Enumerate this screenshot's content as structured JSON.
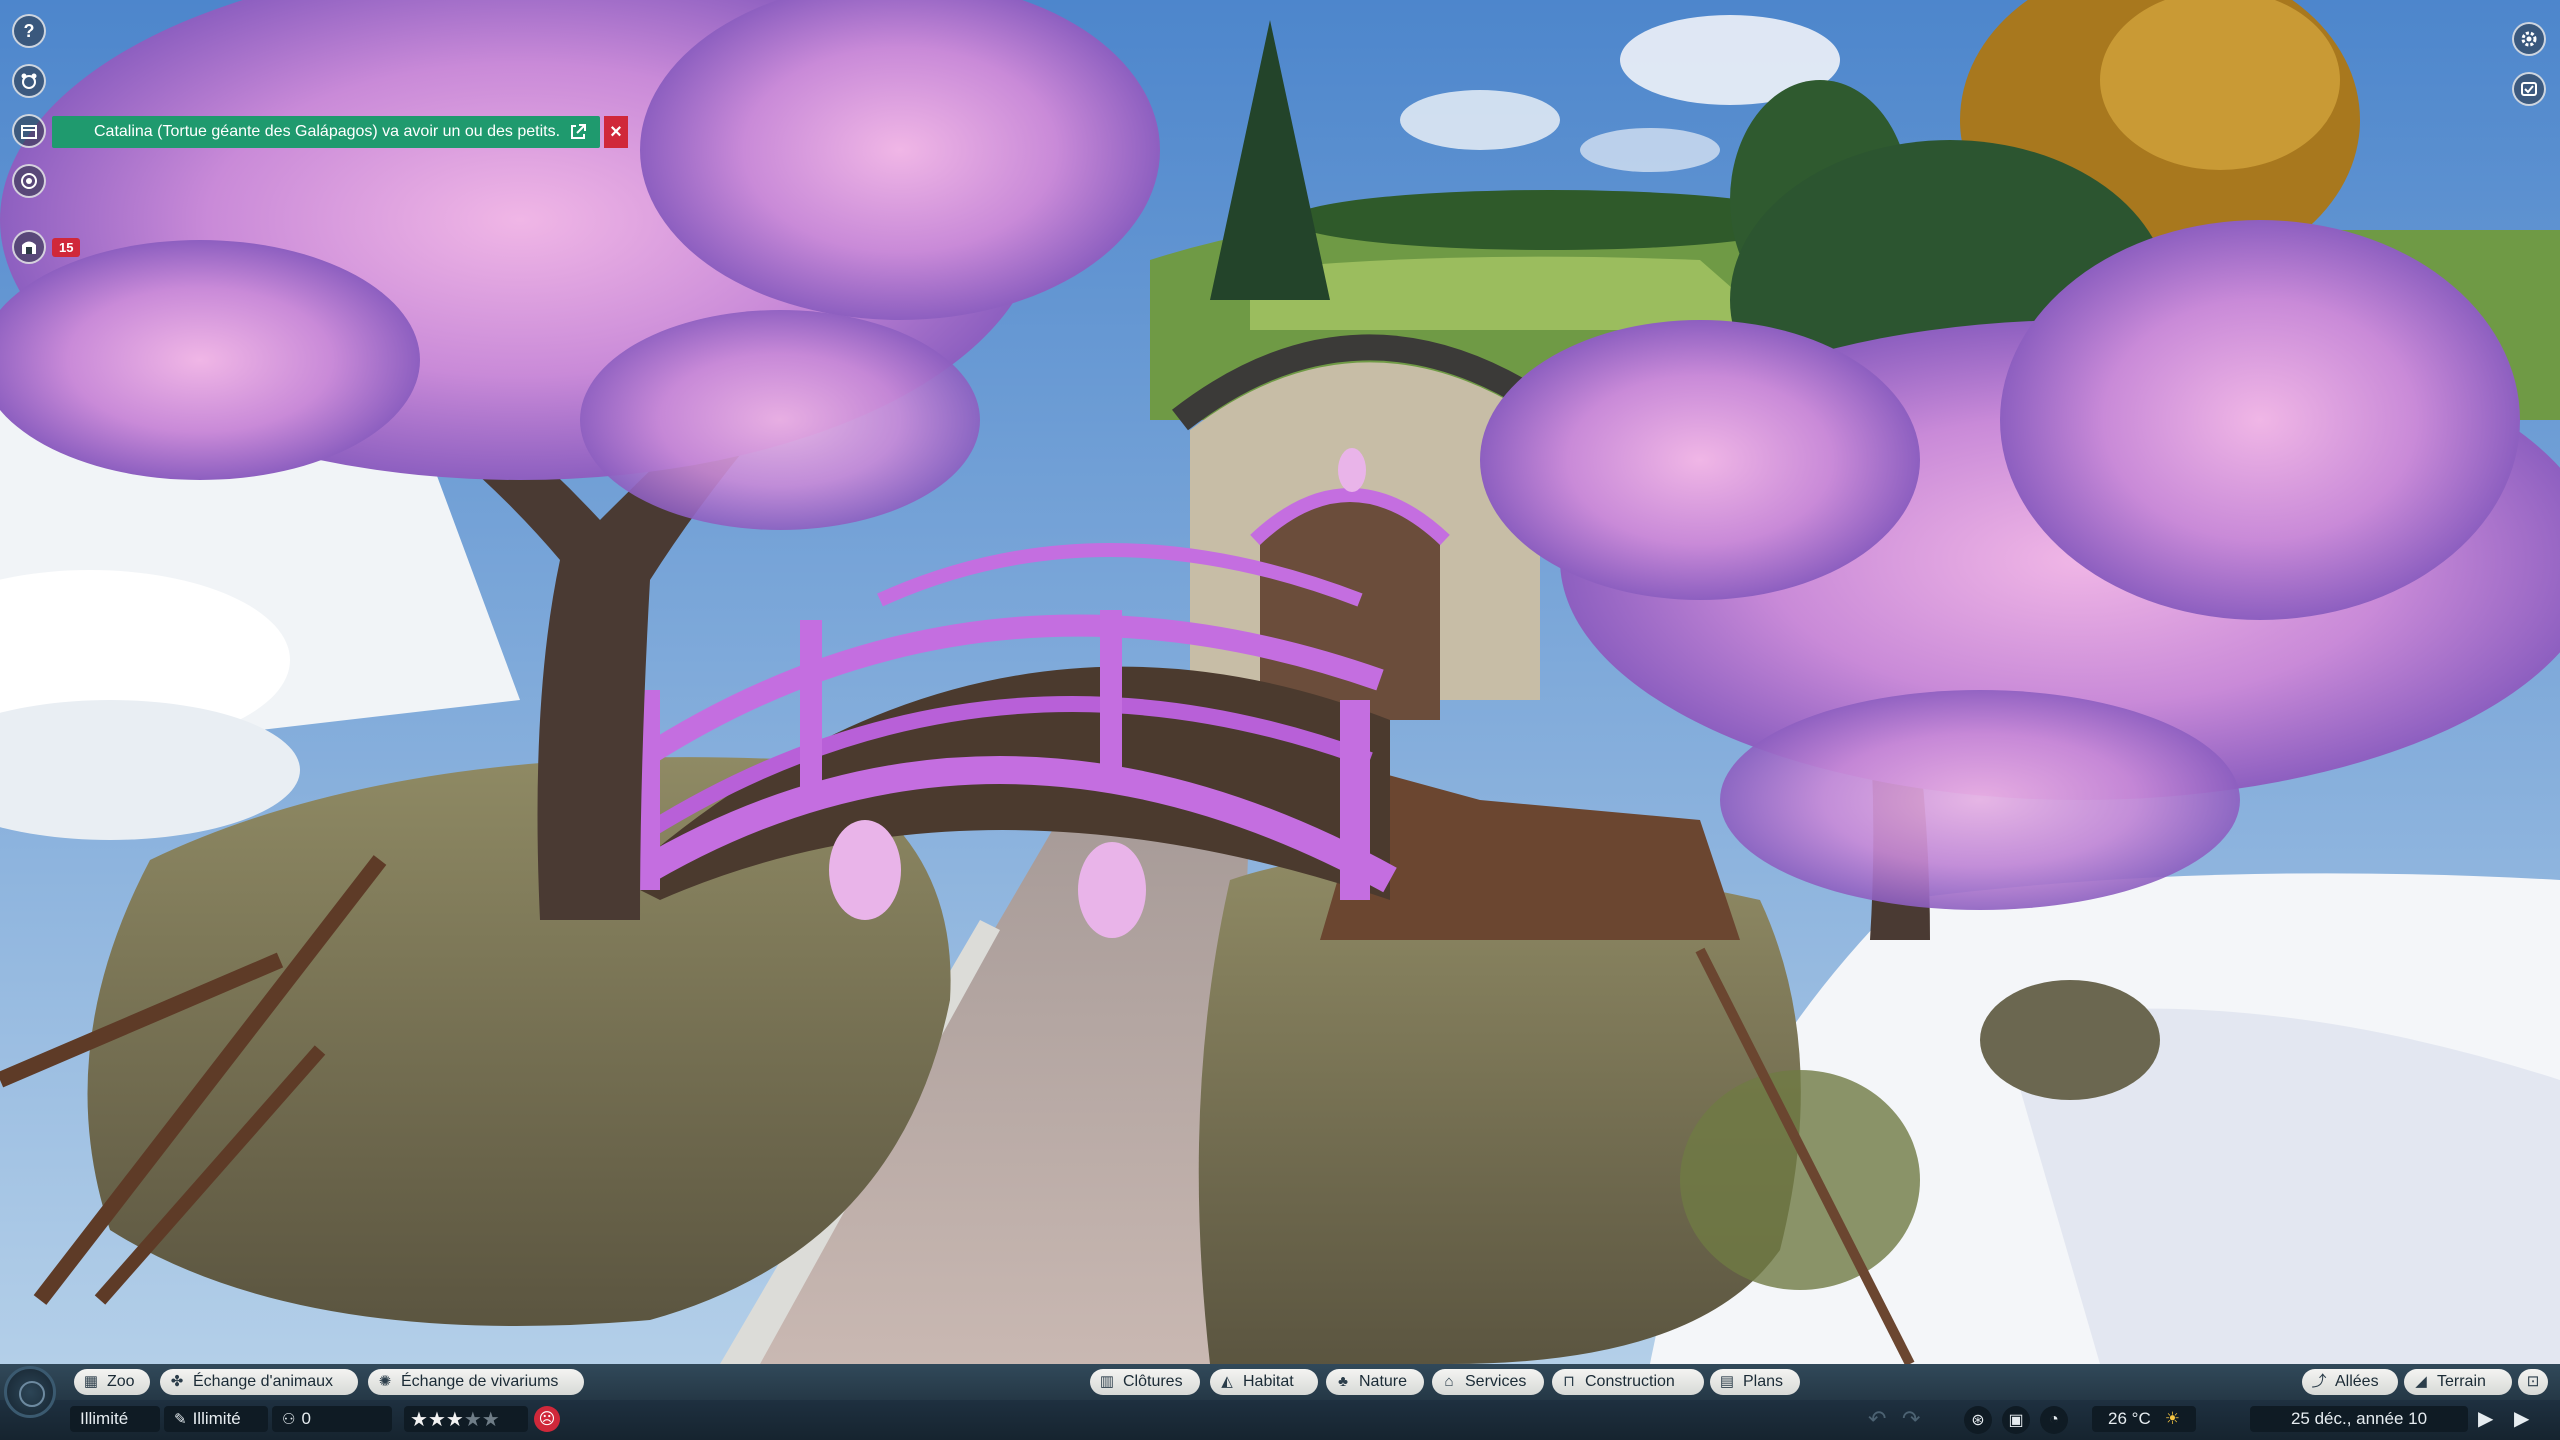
{
  "notification": {
    "message": "Catalina (Tortue géante des Galápagos) va avoir un ou des petits.",
    "close_label": "×"
  },
  "sidebar": {
    "help_label": "?",
    "guests_badge": "15"
  },
  "toolbar_left": [
    {
      "label": "Zoo",
      "icon": "zoo-icon"
    },
    {
      "label": "Échange d'animaux",
      "icon": "paw-icon"
    },
    {
      "label": "Échange de vivariums",
      "icon": "spider-icon"
    }
  ],
  "toolbar_center": [
    {
      "label": "Clôtures",
      "icon": "fence-icon"
    },
    {
      "label": "Habitat",
      "icon": "habitat-icon"
    },
    {
      "label": "Nature",
      "icon": "tree-icon"
    },
    {
      "label": "Services",
      "icon": "shop-icon"
    },
    {
      "label": "Construction",
      "icon": "construction-icon"
    },
    {
      "label": "Plans",
      "icon": "blueprint-icon"
    }
  ],
  "toolbar_right": [
    {
      "label": "Allées",
      "icon": "path-icon"
    },
    {
      "label": "Terrain",
      "icon": "terrain-icon"
    }
  ],
  "status": {
    "money": "Illimité",
    "research": "Illimité",
    "guests": "0",
    "rating_stars": 3,
    "rating_max": 5,
    "temperature": "26 °C",
    "weather": "sun-icon",
    "date": "25 déc., année 10"
  },
  "colors": {
    "notification": "#1f9a6e",
    "alert": "#d0283a",
    "bar": "#253846",
    "blossom": "#c58ad6",
    "bridge": "#c46ee0"
  }
}
